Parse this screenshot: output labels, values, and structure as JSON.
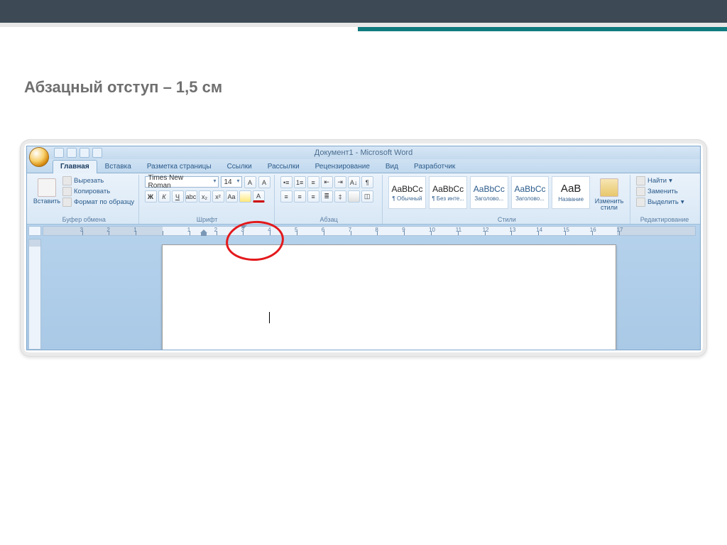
{
  "slide": {
    "title": "Абзацный отступ – 1,5 см"
  },
  "titlebar": {
    "text": "Документ1 - Microsoft Word"
  },
  "tabs": [
    {
      "id": "home",
      "label": "Главная",
      "active": true
    },
    {
      "id": "insert",
      "label": "Вставка",
      "active": false
    },
    {
      "id": "layout",
      "label": "Разметка страницы",
      "active": false
    },
    {
      "id": "references",
      "label": "Ссылки",
      "active": false
    },
    {
      "id": "mailings",
      "label": "Рассылки",
      "active": false
    },
    {
      "id": "review",
      "label": "Рецензирование",
      "active": false
    },
    {
      "id": "view",
      "label": "Вид",
      "active": false
    },
    {
      "id": "developer",
      "label": "Разработчик",
      "active": false
    }
  ],
  "clipboard": {
    "group_label": "Буфер обмена",
    "paste": "Вставить",
    "cut": "Вырезать",
    "copy": "Копировать",
    "format_painter": "Формат по образцу"
  },
  "font": {
    "group_label": "Шрифт",
    "name": "Times New Roman",
    "size": "14"
  },
  "paragraph": {
    "group_label": "Абзац"
  },
  "styles": {
    "group_label": "Стили",
    "change_styles": "Изменить стили",
    "tiles": [
      {
        "preview": "AaBbCc",
        "label": "¶ Обычный"
      },
      {
        "preview": "AaBbCc",
        "label": "¶ Без инте..."
      },
      {
        "preview": "AaBbCc",
        "label": "Заголово..."
      },
      {
        "preview": "AaBbCc",
        "label": "Заголово..."
      },
      {
        "preview": "АаВ",
        "label": "Название"
      }
    ]
  },
  "editing": {
    "group_label": "Редактирование",
    "find": "Найти",
    "replace": "Заменить",
    "select": "Выделить"
  },
  "ruler": {
    "unit": "cm",
    "left_margin_cm": 3,
    "first_line_indent_cm": 1.5,
    "ticks": [
      "3",
      "2",
      "1",
      "",
      "1",
      "2",
      "3",
      "4",
      "5",
      "6",
      "7",
      "8",
      "9",
      "10",
      "11",
      "12",
      "13",
      "14",
      "15",
      "16",
      "17"
    ]
  }
}
